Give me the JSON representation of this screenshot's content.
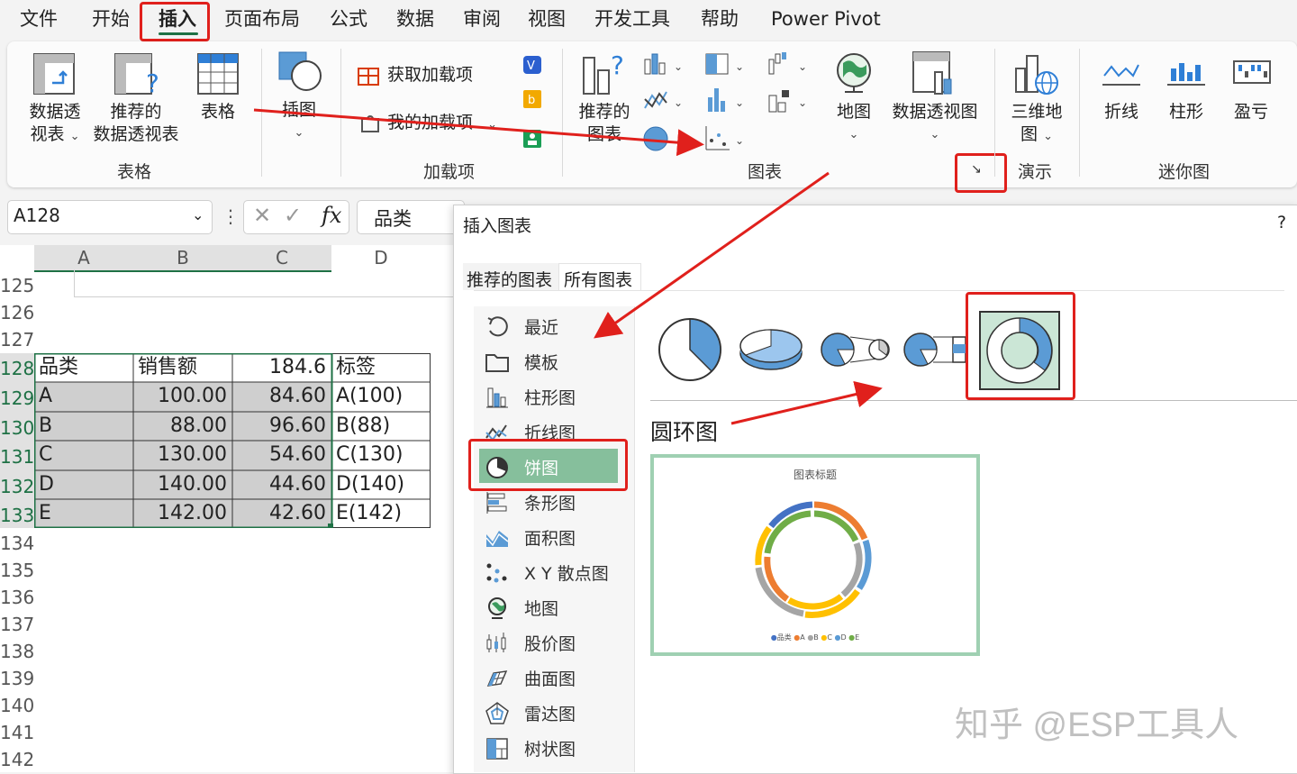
{
  "menu": {
    "items": [
      "文件",
      "开始",
      "插入",
      "页面布局",
      "公式",
      "数据",
      "审阅",
      "视图",
      "开发工具",
      "帮助",
      "Power Pivot"
    ],
    "active": "插入"
  },
  "ribbon": {
    "pivot_label_1": "数据透",
    "pivot_label_2": "视表",
    "rec_pivot_label_1": "推荐的",
    "rec_pivot_label_2": "数据透视表",
    "table_label": "表格",
    "group_tables": "表格",
    "illustrations_label": "插图",
    "get_addins": "获取加载项",
    "my_addins": "我的加载项",
    "group_addins": "加载项",
    "rec_charts_1": "推荐的",
    "rec_charts_2": "图表",
    "group_charts": "图表",
    "maps_label": "地图",
    "pivot_chart_label": "数据透视图",
    "map3d_1": "三维地",
    "map3d_2": "图",
    "group_tours": "演示",
    "spark_line": "折线",
    "spark_column": "柱形",
    "spark_winloss": "盈亏",
    "group_sparklines": "迷你图"
  },
  "formula_bar": {
    "name_box": "A128",
    "fx": "fx",
    "formula": "品类"
  },
  "sheet": {
    "columns": [
      "A",
      "B",
      "C",
      "D"
    ],
    "rows": [
      "125",
      "126",
      "127",
      "128",
      "129",
      "130",
      "131",
      "132",
      "133",
      "134",
      "135",
      "136",
      "137",
      "138",
      "139",
      "140",
      "141",
      "142"
    ],
    "table": [
      [
        "品类",
        "销售额",
        "184.6",
        "标签"
      ],
      [
        "A",
        "100.00",
        "84.60",
        "A(100)"
      ],
      [
        "B",
        "88.00",
        "96.60",
        "B(88)"
      ],
      [
        "C",
        "130.00",
        "54.60",
        "C(130)"
      ],
      [
        "D",
        "140.00",
        "44.60",
        "D(140)"
      ],
      [
        "E",
        "142.00",
        "42.60",
        "E(142)"
      ]
    ]
  },
  "dialog": {
    "title": "插入图表",
    "help": "?",
    "tabs": [
      "推荐的图表",
      "所有图表"
    ],
    "categories": [
      "最近",
      "模板",
      "柱形图",
      "折线图",
      "饼图",
      "条形图",
      "面积图",
      "X Y 散点图",
      "地图",
      "股价图",
      "曲面图",
      "雷达图",
      "树状图"
    ],
    "selected_category": "饼图",
    "selected_subtype": "圆环图",
    "preview": {
      "title": "图表标题",
      "legend": [
        "品类",
        "A",
        "B",
        "C",
        "D",
        "E"
      ],
      "colors": [
        "#4472c4",
        "#ed7d31",
        "#a5a5a5",
        "#ffc000",
        "#5b9bd5",
        "#70ad47"
      ]
    }
  },
  "watermark": "知乎 @ESP工具人"
}
